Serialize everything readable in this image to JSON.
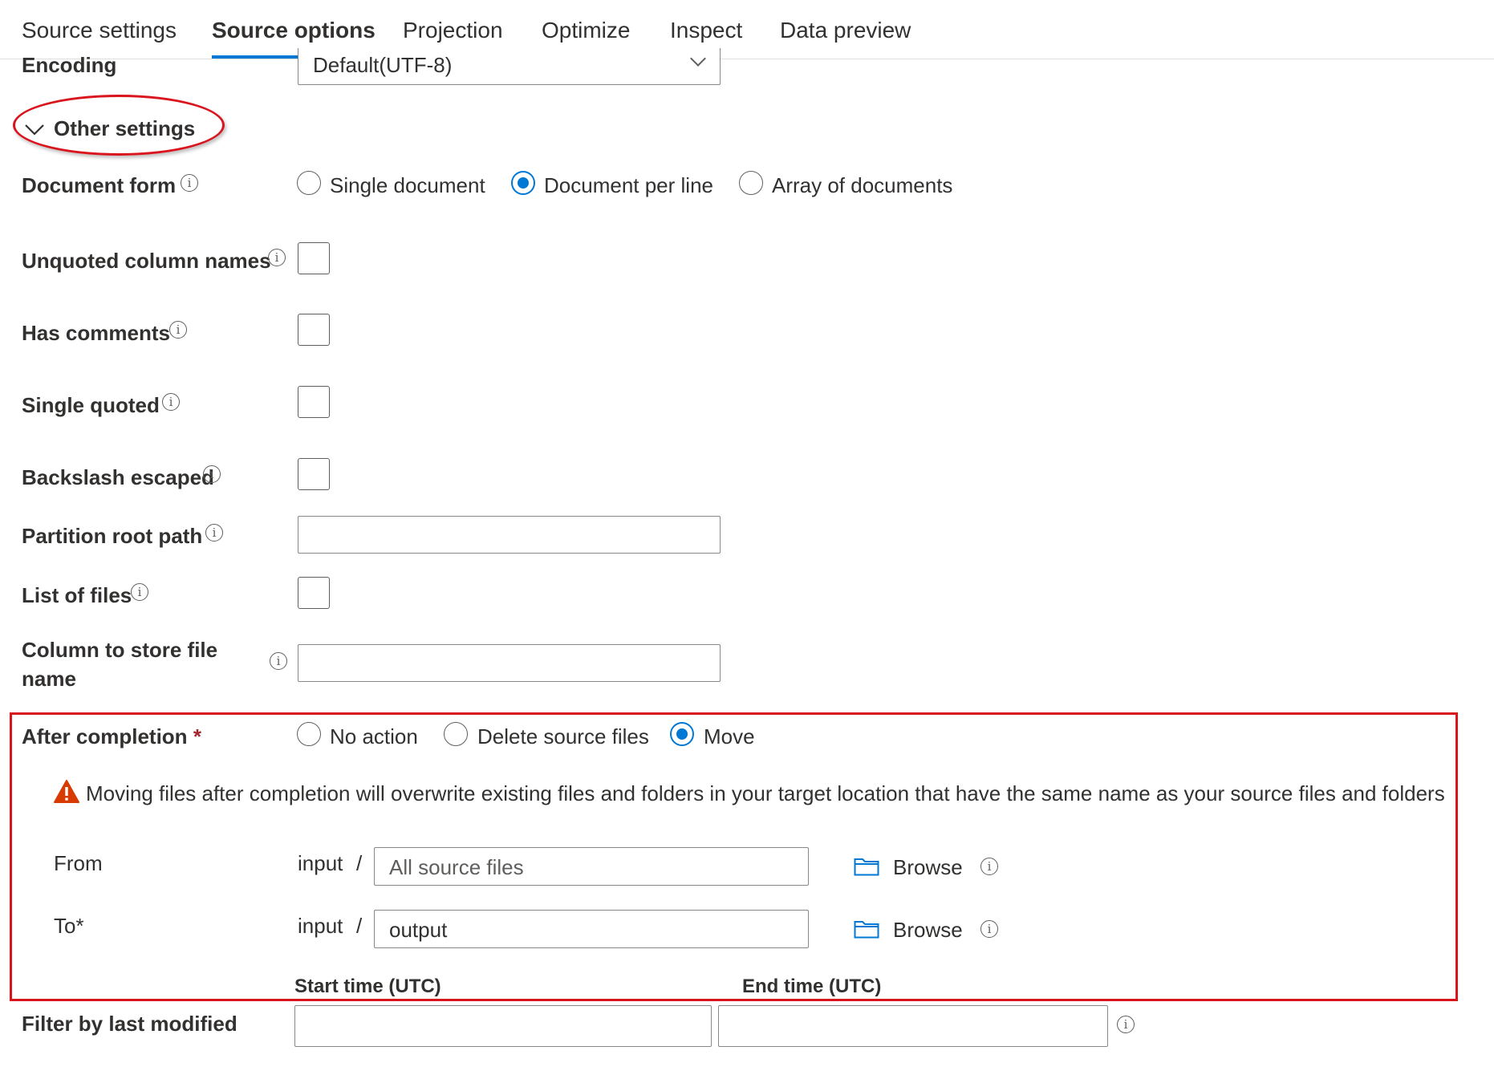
{
  "tabs": [
    {
      "label": "Source settings",
      "active": false
    },
    {
      "label": "Source options",
      "active": true
    },
    {
      "label": "Projection",
      "active": false
    },
    {
      "label": "Optimize",
      "active": false
    },
    {
      "label": "Inspect",
      "active": false
    },
    {
      "label": "Data preview",
      "active": false
    }
  ],
  "encoding": {
    "label": "Encoding",
    "value": "Default(UTF-8)"
  },
  "other_settings": {
    "label": "Other settings",
    "expanded": true
  },
  "document_form": {
    "label": "Document form",
    "options": [
      {
        "label": "Single document",
        "selected": false
      },
      {
        "label": "Document per line",
        "selected": true
      },
      {
        "label": "Array of documents",
        "selected": false
      }
    ]
  },
  "unquoted_column_names": {
    "label": "Unquoted column names",
    "checked": false
  },
  "has_comments": {
    "label": "Has comments",
    "checked": false
  },
  "single_quoted": {
    "label": "Single quoted",
    "checked": false
  },
  "backslash_escaped": {
    "label": "Backslash escaped",
    "checked": false
  },
  "partition_root_path": {
    "label": "Partition root path",
    "value": ""
  },
  "list_of_files": {
    "label": "List of files",
    "checked": false
  },
  "column_to_store_file_name": {
    "label_line1": "Column to store file",
    "label_line2": "name",
    "value": ""
  },
  "after_completion": {
    "label": "After completion",
    "required_mark": "*",
    "options": [
      {
        "label": "No action",
        "selected": false
      },
      {
        "label": "Delete source files",
        "selected": false
      },
      {
        "label": "Move",
        "selected": true
      }
    ],
    "warning": "Moving files after completion will overwrite existing files and folders in your target location that have the same name as your source files and folders",
    "from": {
      "label": "From",
      "prefix": "input",
      "separator": "/",
      "placeholder": "All source files",
      "value": "",
      "browse_label": "Browse"
    },
    "to": {
      "label": "To*",
      "prefix": "input",
      "separator": "/",
      "placeholder": "",
      "value": "output",
      "browse_label": "Browse"
    }
  },
  "filter_by_last_modified": {
    "label": "Filter by last modified",
    "start_label": "Start time (UTC)",
    "end_label": "End time (UTC)",
    "start_value": "",
    "end_value": ""
  },
  "colors": {
    "accent": "#0078d4",
    "annotation_red": "#d9141c",
    "warning_orange": "#d83b01"
  },
  "icons": [
    "chevron-down-icon",
    "info-icon",
    "warning-icon",
    "folder-icon"
  ]
}
